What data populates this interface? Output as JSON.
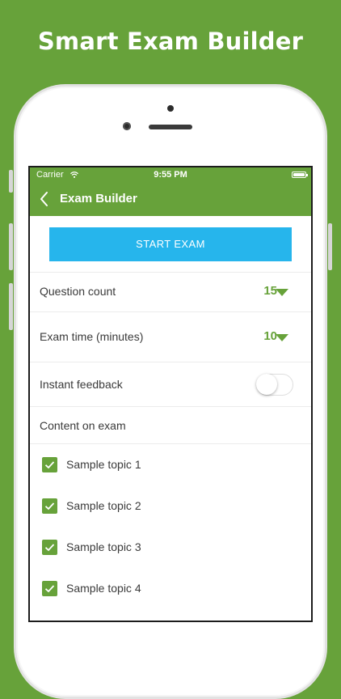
{
  "promo": {
    "headline": "Smart Exam Builder"
  },
  "status_bar": {
    "carrier": "Carrier",
    "time": "9:55 PM"
  },
  "nav": {
    "title": "Exam Builder"
  },
  "builder": {
    "start_label": "START EXAM",
    "question_count": {
      "label": "Question count",
      "value": "15"
    },
    "exam_time": {
      "label": "Exam time (minutes)",
      "value": "10"
    },
    "instant_feedback": {
      "label": "Instant feedback",
      "enabled": false
    },
    "content_header": "Content on exam",
    "topics": [
      {
        "label": "Sample topic 1",
        "checked": true
      },
      {
        "label": "Sample topic 2",
        "checked": true
      },
      {
        "label": "Sample topic 3",
        "checked": true
      },
      {
        "label": "Sample topic 4",
        "checked": true
      }
    ]
  },
  "colors": {
    "brand_green": "#67a23a",
    "start_button_blue": "#26b5ec"
  }
}
